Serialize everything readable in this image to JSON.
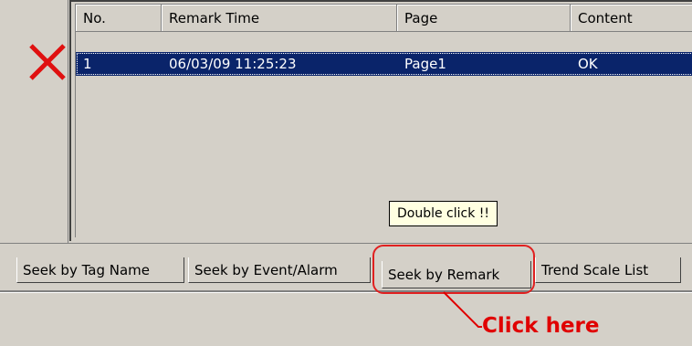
{
  "delete_icon": "close-x-icon",
  "colors": {
    "selection": "#0a246a",
    "accent_red": "#e00000"
  },
  "list": {
    "columns": [
      "No.",
      "Remark Time",
      "Page",
      "Content"
    ],
    "rows": [
      {
        "no": "1",
        "remark_time": "06/03/09 11:25:23",
        "page": "Page1",
        "content": "OK"
      }
    ]
  },
  "tooltip": "Double click !!",
  "tabs": [
    "Seek by Tag Name",
    "Seek by Event/Alarm",
    "Seek by Remark",
    "Trend Scale List"
  ],
  "annotation": "Click here"
}
